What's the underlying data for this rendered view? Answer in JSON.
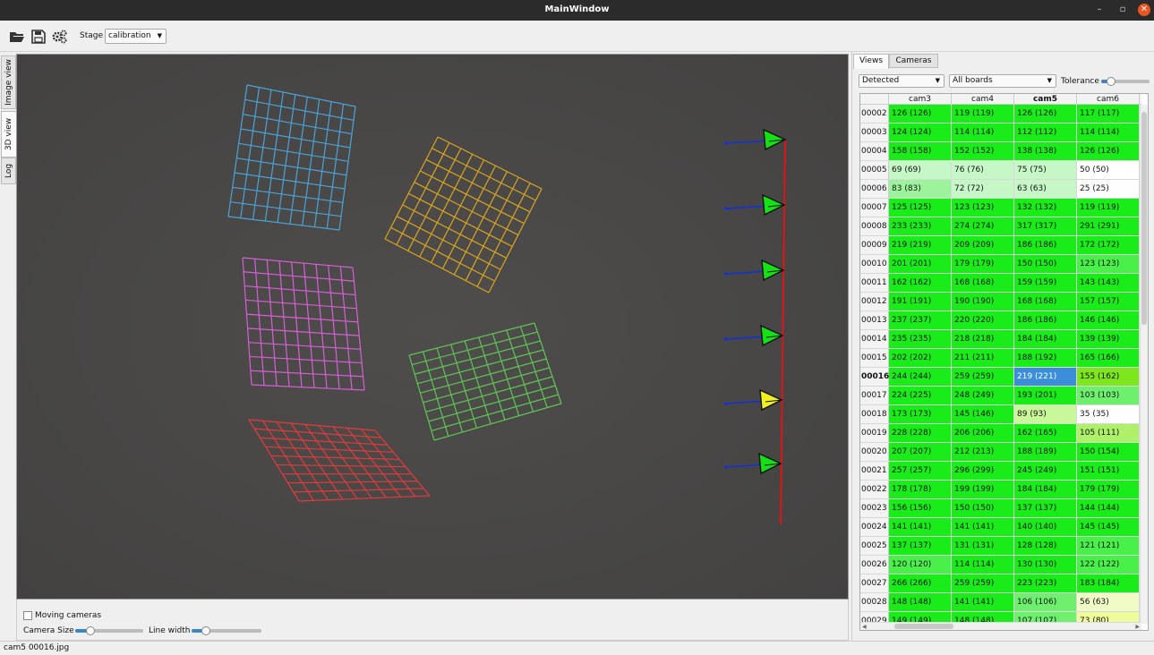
{
  "window": {
    "title": "MainWindow",
    "min_glyph": "–",
    "max_glyph": "▫",
    "close_glyph": "✕"
  },
  "toolbar": {
    "icons": [
      "folder-open-icon",
      "save-icon",
      "gears-icon"
    ],
    "stage_label": "Stage",
    "stage_value": "calibration",
    "dropdown_glyph": "▼"
  },
  "side_tabs": [
    "Image view",
    "3D view",
    "Log"
  ],
  "active_side_tab": "3D view",
  "view_controls": {
    "moving_cameras_label": "Moving cameras",
    "moving_cameras_checked": false,
    "camera_size_label": "Camera Size",
    "camera_size_level": 0.22,
    "line_width_label": "Line width",
    "line_width_level": 0.2
  },
  "scene": {
    "boards": [
      {
        "color": "#4aa3d8"
      },
      {
        "color": "#d9a520"
      },
      {
        "color": "#d65fd6"
      },
      {
        "color": "#5fc455"
      },
      {
        "color": "#e33a3a"
      }
    ],
    "camera_colors": [
      "#16e016",
      "#16e016",
      "#16e016",
      "#16e016",
      "#f0f020",
      "#16e016"
    ],
    "rig_axis_color": "#e01414",
    "camera_axis_color": "#1030e0"
  },
  "right_panel": {
    "tabs": [
      "Views",
      "Cameras"
    ],
    "active_tab": "Views",
    "filter_value": "Detected",
    "boards_value": "All boards",
    "tolerance_label": "Tolerance",
    "tolerance_level": 0.2,
    "table": {
      "columns": [
        "cam3",
        "cam4",
        "cam5",
        "cam6"
      ],
      "bold_column": "cam5",
      "selected_row": "00016",
      "rows": [
        {
          "id": "00002",
          "cells": [
            "126 (126)",
            "119 (119)",
            "126 (126)",
            "117 (117)"
          ],
          "colors": [
            "#19ec19",
            "#19ec19",
            "#19ec19",
            "#19ec19"
          ]
        },
        {
          "id": "00003",
          "cells": [
            "124 (124)",
            "114 (114)",
            "112 (112)",
            "114 (114)"
          ],
          "colors": [
            "#19ec19",
            "#19ec19",
            "#19ec19",
            "#19ec19"
          ]
        },
        {
          "id": "00004",
          "cells": [
            "158 (158)",
            "152 (152)",
            "138 (138)",
            "126 (126)"
          ],
          "colors": [
            "#19ec19",
            "#19ec19",
            "#19ec19",
            "#19ec19"
          ]
        },
        {
          "id": "00005",
          "cells": [
            "69 (69)",
            "76 (76)",
            "75 (75)",
            "50 (50)"
          ],
          "colors": [
            "#c6f7c6",
            "#c6f7c6",
            "#c6f7c6",
            "#ffffff"
          ]
        },
        {
          "id": "00006",
          "cells": [
            "83 (83)",
            "72 (72)",
            "63 (63)",
            "25 (25)"
          ],
          "colors": [
            "#9cf39c",
            "#c6f7c6",
            "#c6f7c6",
            "#ffffff"
          ]
        },
        {
          "id": "00007",
          "cells": [
            "125 (125)",
            "123 (123)",
            "132 (132)",
            "119 (119)"
          ],
          "colors": [
            "#19ec19",
            "#19ec19",
            "#19ec19",
            "#19ec19"
          ]
        },
        {
          "id": "00008",
          "cells": [
            "233 (233)",
            "274 (274)",
            "317 (317)",
            "291 (291)"
          ],
          "colors": [
            "#19ec19",
            "#19ec19",
            "#19ec19",
            "#19ec19"
          ]
        },
        {
          "id": "00009",
          "cells": [
            "219 (219)",
            "209 (209)",
            "186 (186)",
            "172 (172)"
          ],
          "colors": [
            "#19ec19",
            "#19ec19",
            "#19ec19",
            "#19ec19"
          ]
        },
        {
          "id": "00010",
          "cells": [
            "201 (201)",
            "179 (179)",
            "150 (150)",
            "123 (123)"
          ],
          "colors": [
            "#19ec19",
            "#19ec19",
            "#19ec19",
            "#4af04a"
          ]
        },
        {
          "id": "00011",
          "cells": [
            "162 (162)",
            "168 (168)",
            "159 (159)",
            "143 (143)"
          ],
          "colors": [
            "#19ec19",
            "#19ec19",
            "#19ec19",
            "#19ec19"
          ]
        },
        {
          "id": "00012",
          "cells": [
            "191 (191)",
            "190 (190)",
            "168 (168)",
            "157 (157)"
          ],
          "colors": [
            "#19ec19",
            "#19ec19",
            "#19ec19",
            "#19ec19"
          ]
        },
        {
          "id": "00013",
          "cells": [
            "237 (237)",
            "220 (220)",
            "186 (186)",
            "146 (146)"
          ],
          "colors": [
            "#19ec19",
            "#19ec19",
            "#19ec19",
            "#19ec19"
          ]
        },
        {
          "id": "00014",
          "cells": [
            "235 (235)",
            "218 (218)",
            "184 (184)",
            "139 (139)"
          ],
          "colors": [
            "#19ec19",
            "#19ec19",
            "#19ec19",
            "#19ec19"
          ]
        },
        {
          "id": "00015",
          "cells": [
            "202 (202)",
            "211 (211)",
            "188 (192)",
            "165 (166)"
          ],
          "colors": [
            "#19ec19",
            "#19ec19",
            "#19ec19",
            "#19ec19"
          ]
        },
        {
          "id": "00016",
          "cells": [
            "244 (244)",
            "259 (259)",
            "219 (221)",
            "155 (162)"
          ],
          "colors": [
            "#19ec19",
            "#19ec19",
            "#3b8fd9",
            "#7ee61c"
          ]
        },
        {
          "id": "00017",
          "cells": [
            "224 (225)",
            "248 (249)",
            "193 (201)",
            "103 (103)"
          ],
          "colors": [
            "#19ec19",
            "#19ec19",
            "#19ec19",
            "#6ef06e"
          ]
        },
        {
          "id": "00018",
          "cells": [
            "173 (173)",
            "145 (146)",
            "89 (93)",
            "35 (35)"
          ],
          "colors": [
            "#19ec19",
            "#19ec19",
            "#c9f79a",
            "#ffffff"
          ]
        },
        {
          "id": "00019",
          "cells": [
            "228 (228)",
            "206 (206)",
            "162 (165)",
            "105 (111)"
          ],
          "colors": [
            "#19ec19",
            "#19ec19",
            "#19ec19",
            "#aef06a"
          ]
        },
        {
          "id": "00020",
          "cells": [
            "207 (207)",
            "212 (213)",
            "188 (189)",
            "150 (154)"
          ],
          "colors": [
            "#19ec19",
            "#19ec19",
            "#19ec19",
            "#19ec19"
          ]
        },
        {
          "id": "00021",
          "cells": [
            "257 (257)",
            "296 (299)",
            "245 (249)",
            "151 (151)"
          ],
          "colors": [
            "#19ec19",
            "#19ec19",
            "#19ec19",
            "#19ec19"
          ]
        },
        {
          "id": "00022",
          "cells": [
            "178 (178)",
            "199 (199)",
            "184 (184)",
            "179 (179)"
          ],
          "colors": [
            "#19ec19",
            "#19ec19",
            "#19ec19",
            "#19ec19"
          ]
        },
        {
          "id": "00023",
          "cells": [
            "156 (156)",
            "150 (150)",
            "137 (137)",
            "144 (144)"
          ],
          "colors": [
            "#19ec19",
            "#19ec19",
            "#19ec19",
            "#19ec19"
          ]
        },
        {
          "id": "00024",
          "cells": [
            "141 (141)",
            "141 (141)",
            "140 (140)",
            "145 (145)"
          ],
          "colors": [
            "#19ec19",
            "#19ec19",
            "#19ec19",
            "#19ec19"
          ]
        },
        {
          "id": "00025",
          "cells": [
            "137 (137)",
            "131 (131)",
            "128 (128)",
            "121 (121)"
          ],
          "colors": [
            "#19ec19",
            "#19ec19",
            "#19ec19",
            "#4af04a"
          ]
        },
        {
          "id": "00026",
          "cells": [
            "120 (120)",
            "114 (114)",
            "130 (130)",
            "122 (122)"
          ],
          "colors": [
            "#4af04a",
            "#19ec19",
            "#19ec19",
            "#4af04a"
          ]
        },
        {
          "id": "00027",
          "cells": [
            "266 (266)",
            "259 (259)",
            "223 (223)",
            "183 (184)"
          ],
          "colors": [
            "#19ec19",
            "#19ec19",
            "#19ec19",
            "#19ec19"
          ]
        },
        {
          "id": "00028",
          "cells": [
            "148 (148)",
            "141 (141)",
            "106 (106)",
            "56 (63)"
          ],
          "colors": [
            "#19ec19",
            "#19ec19",
            "#6ef06e",
            "#f0fbc6"
          ]
        },
        {
          "id": "00029",
          "cells": [
            "149 (149)",
            "148 (148)",
            "107 (107)",
            "73 (80)"
          ],
          "colors": [
            "#19ec19",
            "#19ec19",
            "#6ef06e",
            "#eefb9a"
          ]
        }
      ]
    }
  },
  "status": {
    "text": "cam5 00016.jpg"
  }
}
